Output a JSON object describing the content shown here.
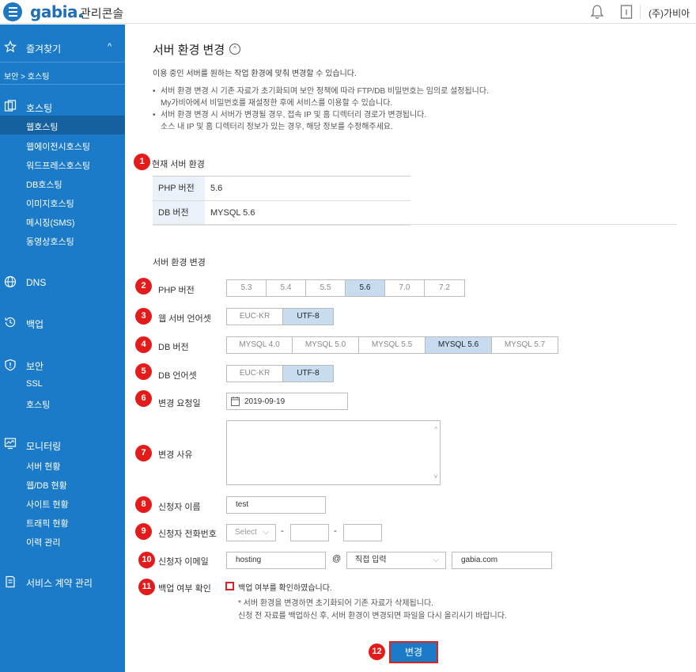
{
  "header": {
    "logo": "gabia.",
    "console": "관리콘솔",
    "user": "(주)가비아"
  },
  "sidebar": {
    "favorites": "즐겨찾기",
    "breadcrumb": "보안 > 호스팅",
    "hosting": {
      "label": "호스팅",
      "items": [
        "웹호스팅",
        "웹에이전시호스팅",
        "워드프레스호스팅",
        "DB호스팅",
        "이미지호스팅",
        "메시징(SMS)",
        "동영상호스팅"
      ]
    },
    "dns": "DNS",
    "backup": "백업",
    "security": {
      "label": "보안",
      "items": [
        "SSL",
        "호스팅"
      ]
    },
    "monitoring": {
      "label": "모니터링",
      "items": [
        "서버 현황",
        "웹/DB 현황",
        "사이트 현황",
        "트래픽 현황",
        "이력 관리"
      ]
    },
    "contract": "서비스 계약 관리"
  },
  "page": {
    "title": "서버 환경 변경",
    "intro": "이용 중인 서버를 원하는 작업 환경에 맞춰 변경할 수 있습니다.",
    "bullets": [
      [
        "서버 환경 변경 시 기존 자료가 초기화되며 보안 정책에 따라 FTP/DB 비밀번호는 임의로 설정됩니다.",
        "My가비아에서 비밀번호를 재설정한 후에 서비스를 이용할 수 있습니다."
      ],
      [
        "서버 환경 변경 시 서버가 변경될 경우, 접속 IP 및 홈 디렉터리 경로가 변경됩니다.",
        "소스 내 IP 및 홈 디렉터리 정보가 있는 경우, 해당 정보를 수정해주세요."
      ]
    ]
  },
  "current": {
    "section": "현재 서버 환경",
    "rows": [
      {
        "k": "PHP 버전",
        "v": "5.6"
      },
      {
        "k": "DB 버전",
        "v": "MYSQL 5.6"
      }
    ]
  },
  "change": {
    "section": "서버 환경 변경",
    "php_label": "PHP 버전",
    "php_options": [
      "5.3",
      "5.4",
      "5.5",
      "5.6",
      "7.0",
      "7.2"
    ],
    "php_selected": "5.6",
    "web_charset_label": "웹 서버 언어셋",
    "web_charset_options": [
      "EUC-KR",
      "UTF-8"
    ],
    "db_label": "DB 버전",
    "db_options": [
      "MYSQL 4.0",
      "MYSQL 5.0",
      "MYSQL 5.5",
      "MYSQL 5.6",
      "MYSQL 5.7"
    ],
    "db_charset_label": "DB 언어셋",
    "db_charset_options": [
      "EUC-KR",
      "UTF-8"
    ],
    "date_label": "변경 요청일",
    "date_value": "2019-09-19",
    "reason_label": "변경 사유",
    "name_label": "신청자 이름",
    "name_value": "test",
    "phone_label": "신청자 전화번호",
    "phone_select": "Select",
    "phone_dash": "-",
    "email_label": "신청자 이메일",
    "email_id": "hosting",
    "email_at": "@",
    "email_domain_select": "직접 입력",
    "email_domain": "gabia.com",
    "backup_label": "백업 여부 확인",
    "backup_check": "백업 여부를 확인하였습니다.",
    "notes": [
      "* 서버 환경을 변경하면 초기화되어 기존 자료가 삭제됩니다.",
      "신청 전 자료를 백업하신 후, 서버 환경이 변경되면 파일을 다시 올리시기 바랍니다."
    ],
    "submit": "변경"
  },
  "badges": [
    "1",
    "2",
    "3",
    "4",
    "5",
    "6",
    "7",
    "8",
    "9",
    "10",
    "11",
    "12"
  ],
  "colors": {
    "accent": "#1b7bc8",
    "highlight": "#e31b1b",
    "selected": "#c8dcf0"
  }
}
